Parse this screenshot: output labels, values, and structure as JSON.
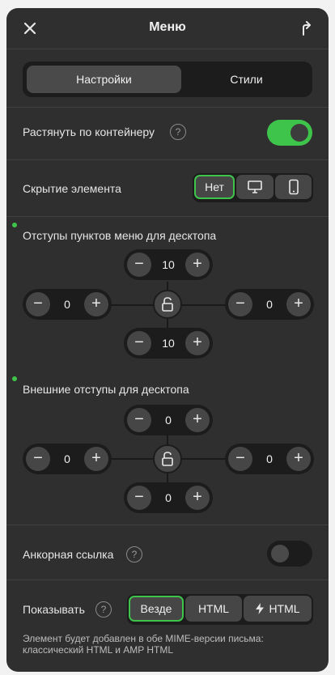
{
  "header": {
    "title": "Меню",
    "close_icon": "close-icon",
    "share_icon": "share-arrow-icon"
  },
  "tabs": [
    {
      "label": "Настройки",
      "active": true
    },
    {
      "label": "Стили",
      "active": false
    }
  ],
  "stretch": {
    "label": "Растянуть по контейнеру",
    "help": "?",
    "enabled": true
  },
  "hiding": {
    "label": "Скрытие элемента",
    "options": [
      "Нет",
      "desktop-icon",
      "mobile-icon"
    ],
    "selected": "Нет"
  },
  "item_padding": {
    "label": "Отступы пунктов меню для десктопа",
    "top": "10",
    "left": "0",
    "right": "0",
    "bottom": "10"
  },
  "outer_padding": {
    "label": "Внешние отступы для десктопа",
    "top": "0",
    "left": "0",
    "right": "0",
    "bottom": "0"
  },
  "anchor": {
    "label": "Анкорная ссылка",
    "help": "?",
    "enabled": false
  },
  "show": {
    "label": "Показывать",
    "help": "?",
    "options": [
      "Везде",
      "HTML",
      "HTML"
    ],
    "selected": "Везде",
    "amp_icon": "lightning-icon"
  },
  "note": "Элемент будет добавлен в обе MIME-версии письма: классический HTML и AMP HTML",
  "colors": {
    "panel": "#2f2f2f",
    "accent": "#3ec44b",
    "dark": "#1c1c1c"
  }
}
